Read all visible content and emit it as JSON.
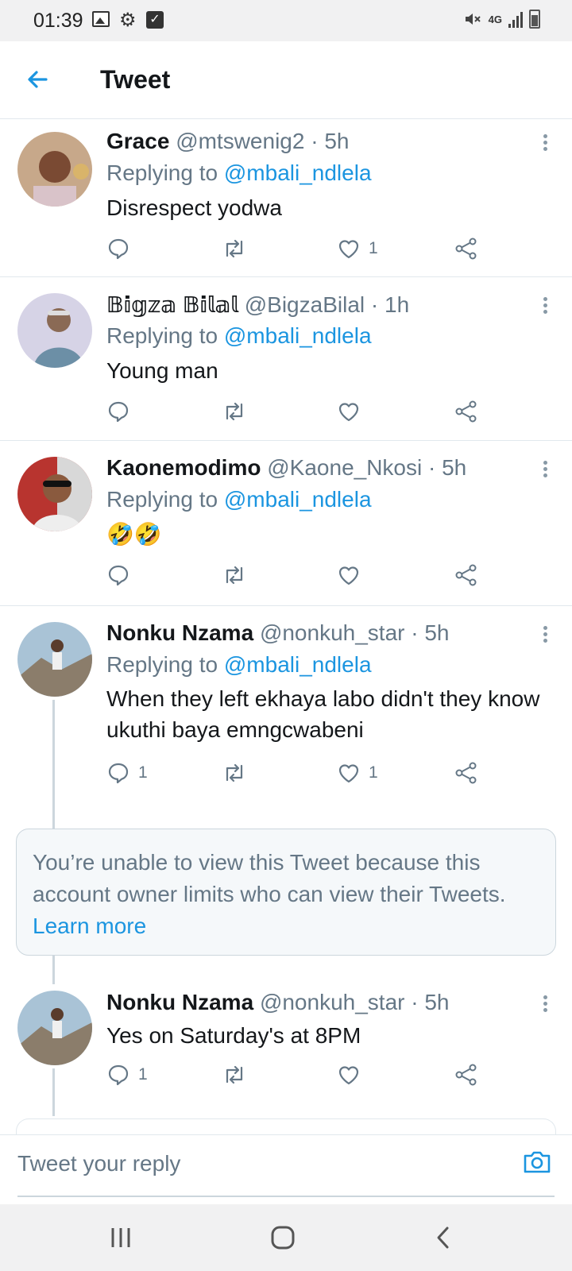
{
  "status_bar": {
    "time": "01:39",
    "network": "4G",
    "icons": [
      "image-icon",
      "gear-icon",
      "check-box-icon",
      "mute-icon",
      "signal-icon",
      "battery-icon"
    ]
  },
  "header": {
    "title": "Tweet",
    "back_icon": "back-arrow-icon"
  },
  "colors": {
    "accent": "#1b95e0",
    "text_primary": "#14171a",
    "text_secondary": "#657786",
    "border": "#e1e8ed"
  },
  "tweets": [
    {
      "name": "Grace",
      "handle": "@mtswenig2 · 5h",
      "replying_prefix": "Replying to ",
      "replying_to": "@mbali_ndlela",
      "text": "Disrespect yodwa",
      "reply_count": "",
      "like_count": "1"
    },
    {
      "name": "𝔹𝕚𝕘𝕫𝕒 𝔹𝕚𝕝𝕒𝕝",
      "handle": "@BigzaBilal · 1h",
      "replying_prefix": "Replying to ",
      "replying_to": "@mbali_ndlela",
      "text": "Young man",
      "reply_count": "",
      "like_count": ""
    },
    {
      "name": "Kaonemodimo",
      "handle": "@Kaone_Nkosi · 5h",
      "replying_prefix": "Replying to ",
      "replying_to": "@mbali_ndlela",
      "text": "🤣🤣",
      "reply_count": "",
      "like_count": ""
    },
    {
      "name": "Nonku Nzama",
      "handle": "@nonkuh_star · 5h",
      "replying_prefix": "Replying to ",
      "replying_to": "@mbali_ndlela",
      "text": "When they left ekhaya labo didn't they know ukuthi baya emngcwabeni",
      "reply_count": "1",
      "like_count": "1"
    },
    {
      "name": "Nonku Nzama",
      "handle": "@nonkuh_star · 5h",
      "text": "Yes on Saturday's at 8PM",
      "reply_count": "1",
      "like_count": ""
    }
  ],
  "unavailable": {
    "text": "You’re unable to view this Tweet because this account owner limits who can view their Tweets. ",
    "link": "Learn more"
  },
  "reply_bar": {
    "placeholder": "Tweet your reply",
    "camera_icon": "camera-icon"
  },
  "nav_bar": {
    "icons": [
      "recents-icon",
      "home-icon",
      "back-icon"
    ]
  }
}
